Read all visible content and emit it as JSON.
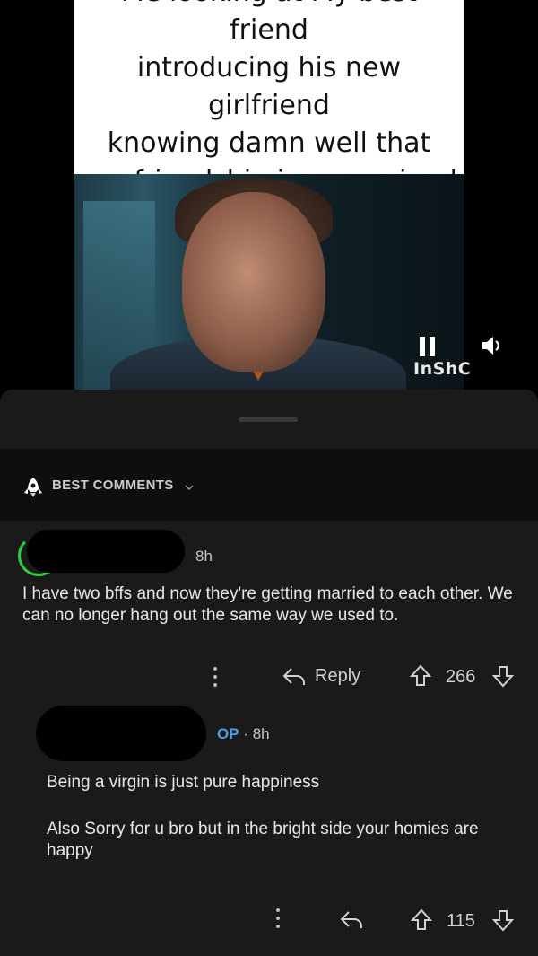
{
  "meme": {
    "caption": "Me looking at My best friend\nintroducing his new girlfriend\nknowing damn well that\nour friendship is now ruined",
    "watermark": "InShC",
    "controls": {
      "pause_icon": "pause-icon",
      "volume_icon": "volume-icon"
    }
  },
  "sort": {
    "label": "BEST COMMENTS",
    "icon": "rocket-icon",
    "chevron": "chevron-down-icon"
  },
  "comments": [
    {
      "time": "8h",
      "body": [
        "I have two bffs and now they're getting married to each other. We can no longer hang out the same way we used to."
      ],
      "reply_label": "Reply",
      "score": "266"
    },
    {
      "badge": "OP",
      "separator": "·",
      "time": "8h",
      "body": [
        "Being a virgin is just pure happiness",
        "Also Sorry for u bro but in the bright side your homies are happy"
      ],
      "score": "115"
    }
  ],
  "colors": {
    "background": "#1a1a1b",
    "op_badge": "#4c9fe8",
    "avatar_ring": "#2ecc40"
  }
}
